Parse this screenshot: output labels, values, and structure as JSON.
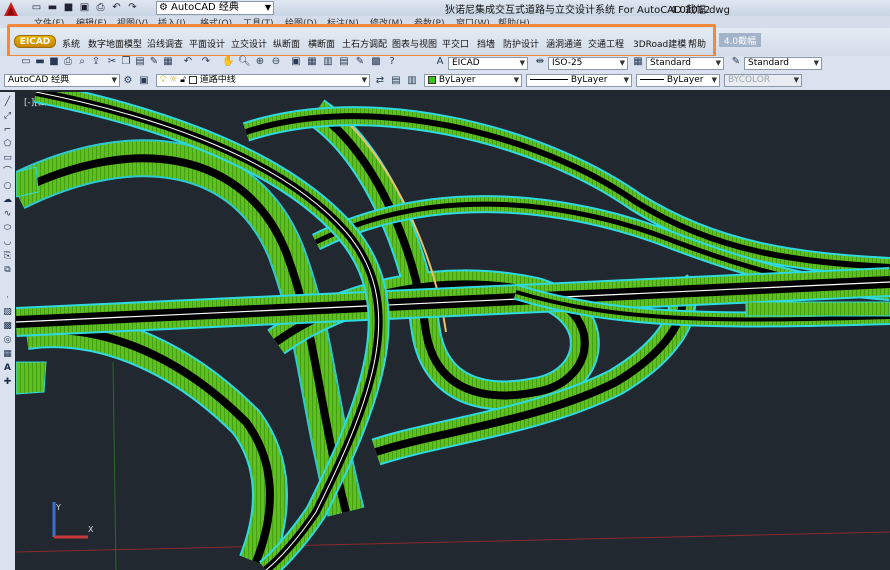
{
  "title_bar": {
    "app_title": "狄诺尼集成交互式道路与立交设计系统 For AutoCAD 2012",
    "file_name": "4.0截幅.dwg",
    "workspace": "AutoCAD 经典"
  },
  "menu": [
    "文件(F)",
    "编辑(E)",
    "视图(V)",
    "插入(I)",
    "格式(O)",
    "工具(T)",
    "绘图(D)",
    "标注(N)",
    "修改(M)",
    "参数(P)",
    "窗口(W)",
    "帮助(H)"
  ],
  "ribbon": {
    "logo": "EICAD",
    "tabs": [
      "系统",
      "数字地面模型",
      "沿线调查",
      "平面设计",
      "立交设计",
      "纵断面",
      "横断面",
      "土石方调配",
      "图表与视图",
      "平交口",
      "挡墙",
      "防护设计",
      "涵洞通道",
      "交通工程",
      "3DRoad建模",
      "帮助"
    ],
    "version_tag": "4.0截幅",
    "highlight_color": "#f08a3a"
  },
  "toolbar1": {
    "text_style": "EICAD",
    "dim_style": "ISO-25",
    "table_style": "Standard",
    "multileader_style": "Standard"
  },
  "toolbar2": {
    "workspace": "AutoCAD 经典",
    "layer": "道路中线",
    "color": "ByLayer",
    "linetype": "ByLayer",
    "lineweight": "ByLayer",
    "plotstyle": "BYCOLOR"
  },
  "canvas": {
    "viewport_label": "[-][西南等轴测][概念]",
    "background": "#212830",
    "road_colors": {
      "embankment": "#5cc21b",
      "edge": "#2fd9e0",
      "pavement": "#000000",
      "centerline": "#ffffff",
      "ramp_accent": "#e8c36a"
    }
  },
  "ucs": {
    "x": "X",
    "y": "Y"
  }
}
